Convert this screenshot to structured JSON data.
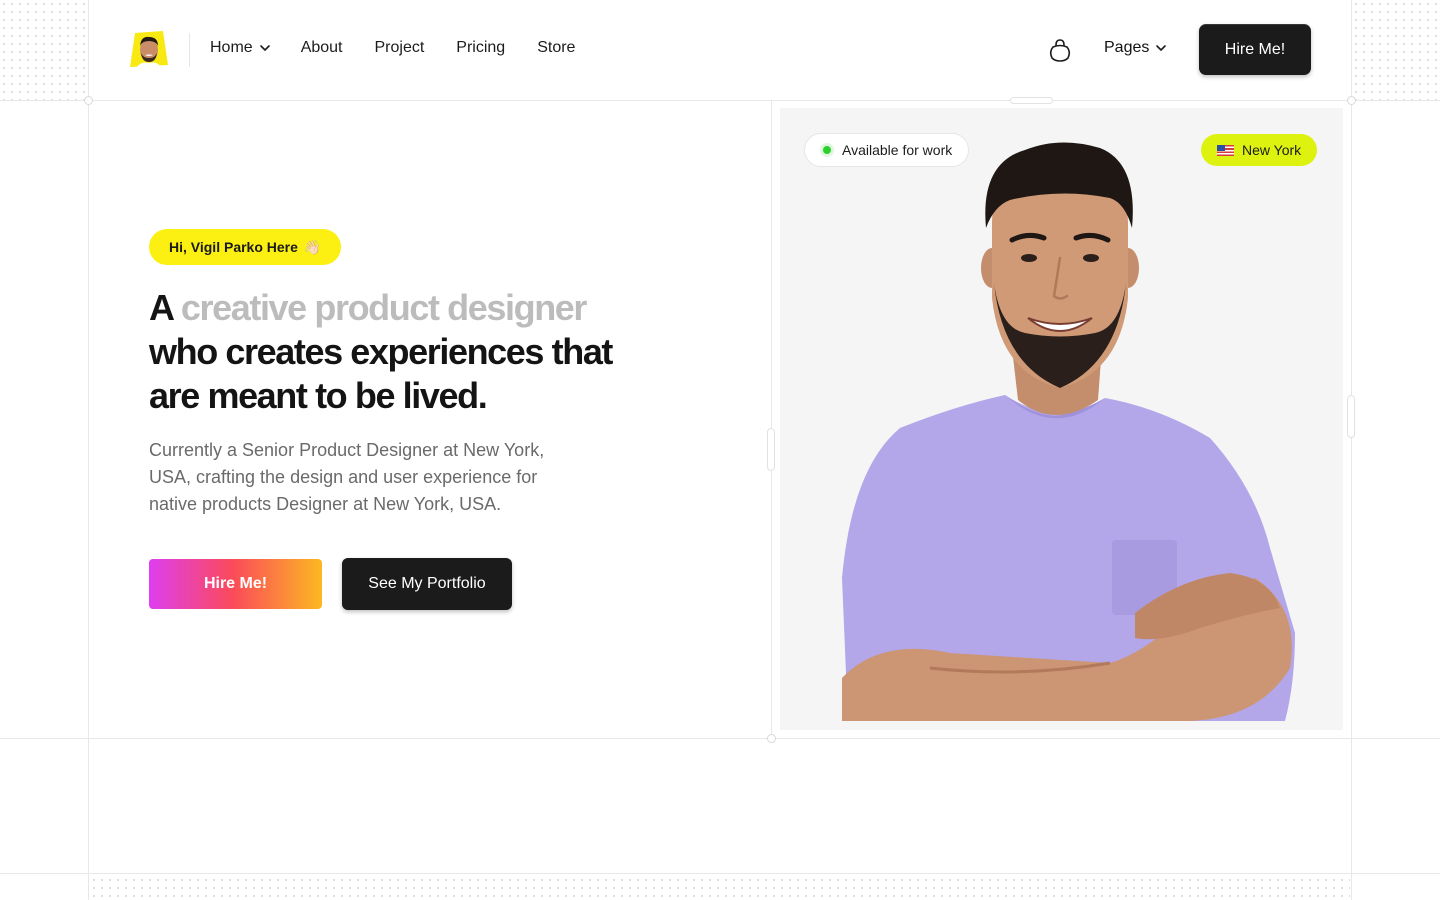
{
  "nav": {
    "items": [
      "Home",
      "About",
      "Project",
      "Pricing",
      "Store"
    ],
    "pages_label": "Pages",
    "hire_label": "Hire Me!",
    "cart_icon": "shopping-bag-icon"
  },
  "hero": {
    "greeting": "Hi, Vigil Parko Here",
    "greeting_emoji": "👋🏻",
    "headline_prefix": "A",
    "headline_muted": "creative product designer",
    "headline_rest": "who creates experiences that are meant to be lived.",
    "description": "Currently a Senior Product Designer at New York, USA, crafting the design and user experience for native products Designer at New York, USA.",
    "primary_cta": "Hire Me!",
    "secondary_cta": "See My Portfolio"
  },
  "profile": {
    "status": "Available for work",
    "location": "New York"
  },
  "colors": {
    "accent_yellow": "#fbf011",
    "location_lime": "#ddf20f",
    "dark": "#1b1b1b",
    "gradient": [
      "#de3ef0",
      "#fb4a5a",
      "#fdb822"
    ],
    "shirt": "#b3a7ea",
    "status_green": "#2bd12b"
  }
}
